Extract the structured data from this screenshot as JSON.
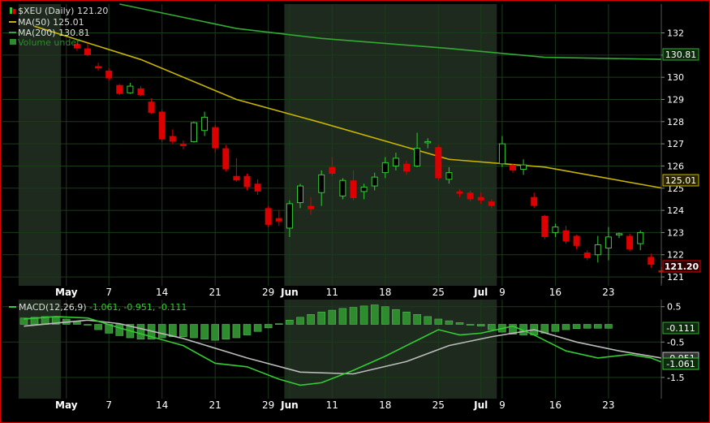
{
  "colors": {
    "background": "#000000",
    "grid": "#1a3d1a",
    "shade": "#1d2a1d",
    "up": "#33cc33",
    "down": "#dd0000",
    "ma50": "#c8b400",
    "ma200": "#33aa33",
    "text": "#ffffff",
    "legend_text": "#dddddd",
    "macd_line": "#33cc33",
    "signal_line": "#bbbbbb",
    "histogram": "#2e8b2e",
    "axis_border": "#dd0000"
  },
  "legend": {
    "symbol_line": "$XEU (Daily) 121.20",
    "ma50": "MA(50) 125.01",
    "ma200": "MA(200) 130.81",
    "volume": "Volume undef"
  },
  "macd_legend": {
    "label": "MACD(12,26,9)",
    "values": "-1.061, -0.951, -0.111"
  },
  "price_badges": {
    "ma200": "130.81",
    "ma50": "125.01",
    "last": "121.20"
  },
  "macd_badges": {
    "histogram": "-0.111",
    "signal": "-0.951",
    "macd": "-1.061"
  },
  "chart_data": {
    "type": "candlestick",
    "title": "$XEU (Daily) 121.20",
    "price_axis": {
      "ticks": [
        121,
        122,
        123,
        124,
        125,
        126,
        127,
        128,
        129,
        130,
        131,
        132
      ],
      "range": [
        120.6,
        133.3
      ]
    },
    "macd_axis": {
      "ticks": [
        "0.5",
        "-0.5",
        "-1.5"
      ],
      "tick_values": [
        0.5,
        -0.5,
        -1.5
      ],
      "range": [
        -2.1,
        0.7
      ]
    },
    "x_ticks": [
      {
        "label": "May",
        "i": -2,
        "bold": true
      },
      {
        "label": "7",
        "i": 2,
        "bold": false
      },
      {
        "label": "14",
        "i": 7,
        "bold": false
      },
      {
        "label": "21",
        "i": 12,
        "bold": false
      },
      {
        "label": "29",
        "i": 17,
        "bold": false
      },
      {
        "label": "Jun",
        "i": 19,
        "bold": true
      },
      {
        "label": "11",
        "i": 23,
        "bold": false
      },
      {
        "label": "18",
        "i": 28,
        "bold": false
      },
      {
        "label": "25",
        "i": 33,
        "bold": false
      },
      {
        "label": "Jul",
        "i": 37,
        "bold": true
      },
      {
        "label": "9",
        "i": 39,
        "bold": false
      },
      {
        "label": "16",
        "i": 44,
        "bold": false
      },
      {
        "label": "23",
        "i": 49,
        "bold": false
      }
    ],
    "shaded_ranges": [
      [
        -6.5,
        -2.5
      ],
      [
        18.5,
        38.5
      ]
    ],
    "candles": [
      [
        131.5,
        131.55,
        131.2,
        131.3
      ],
      [
        131.3,
        131.5,
        130.95,
        131.0
      ],
      [
        130.5,
        130.65,
        130.3,
        130.4
      ],
      [
        130.3,
        130.4,
        129.85,
        129.95
      ],
      [
        129.65,
        129.7,
        129.2,
        129.25
      ],
      [
        129.3,
        129.75,
        129.25,
        129.6
      ],
      [
        129.5,
        129.6,
        129.15,
        129.2
      ],
      [
        128.9,
        129.05,
        128.35,
        128.4
      ],
      [
        128.45,
        128.55,
        127.1,
        127.2
      ],
      [
        127.35,
        127.65,
        127.0,
        127.1
      ],
      [
        127.0,
        127.15,
        126.75,
        126.9
      ],
      [
        127.1,
        128.0,
        127.05,
        127.95
      ],
      [
        127.6,
        128.45,
        127.35,
        128.2
      ],
      [
        127.75,
        127.85,
        126.6,
        126.8
      ],
      [
        126.8,
        126.95,
        125.75,
        125.85
      ],
      [
        125.55,
        126.35,
        125.3,
        125.35
      ],
      [
        125.55,
        125.65,
        124.9,
        125.05
      ],
      [
        125.2,
        125.4,
        124.7,
        124.85
      ],
      [
        124.1,
        124.2,
        123.25,
        123.35
      ],
      [
        123.65,
        124.0,
        123.3,
        123.5
      ],
      [
        123.2,
        124.45,
        122.8,
        124.3
      ],
      [
        124.35,
        125.2,
        124.1,
        125.1
      ],
      [
        124.2,
        124.6,
        123.8,
        124.05
      ],
      [
        124.8,
        125.8,
        124.2,
        125.6
      ],
      [
        125.95,
        126.4,
        125.55,
        125.65
      ],
      [
        124.65,
        125.45,
        124.5,
        125.35
      ],
      [
        125.35,
        125.8,
        124.45,
        124.55
      ],
      [
        124.85,
        125.2,
        124.5,
        125.05
      ],
      [
        125.1,
        125.7,
        124.9,
        125.5
      ],
      [
        125.7,
        126.4,
        125.45,
        126.15
      ],
      [
        126.0,
        126.6,
        125.8,
        126.35
      ],
      [
        126.1,
        126.25,
        125.6,
        125.75
      ],
      [
        126.0,
        127.5,
        125.95,
        126.8
      ],
      [
        127.05,
        127.25,
        126.8,
        127.1
      ],
      [
        126.85,
        126.95,
        125.35,
        125.45
      ],
      [
        125.4,
        125.95,
        125.2,
        125.7
      ],
      [
        124.85,
        124.95,
        124.6,
        124.75
      ],
      [
        124.8,
        124.9,
        124.4,
        124.5
      ],
      [
        124.6,
        124.8,
        124.3,
        124.45
      ],
      [
        124.4,
        124.5,
        124.1,
        124.2
      ],
      [
        126.1,
        127.35,
        125.95,
        127.0
      ],
      [
        126.05,
        126.1,
        125.7,
        125.8
      ],
      [
        125.85,
        126.3,
        125.6,
        126.05
      ],
      [
        124.6,
        124.8,
        124.1,
        124.2
      ],
      [
        123.75,
        123.8,
        122.7,
        122.8
      ],
      [
        123.0,
        123.4,
        122.8,
        123.25
      ],
      [
        123.1,
        123.3,
        122.5,
        122.6
      ],
      [
        122.85,
        122.9,
        122.25,
        122.4
      ],
      [
        122.1,
        122.2,
        121.75,
        121.85
      ],
      [
        122.0,
        122.85,
        121.65,
        122.45
      ],
      [
        122.3,
        123.25,
        121.75,
        122.8
      ],
      [
        122.9,
        123.0,
        122.75,
        122.95
      ],
      [
        122.85,
        122.95,
        122.15,
        122.25
      ],
      [
        122.5,
        123.1,
        122.2,
        123.0
      ],
      [
        121.9,
        122.05,
        121.4,
        121.55
      ],
      [
        121.3,
        121.45,
        120.7,
        121.2
      ]
    ],
    "ma50": [
      [
        -5,
        132.3
      ],
      [
        5,
        130.8
      ],
      [
        14,
        129.0
      ],
      [
        22,
        127.95
      ],
      [
        34,
        126.3
      ],
      [
        43,
        125.95
      ],
      [
        54,
        125.01
      ]
    ],
    "ma200": [
      [
        3,
        133.3
      ],
      [
        14,
        132.2
      ],
      [
        22,
        131.75
      ],
      [
        34,
        131.3
      ],
      [
        43,
        130.9
      ],
      [
        54,
        130.81
      ]
    ],
    "macd": [
      [
        -6,
        0.15
      ],
      [
        -3,
        0.22
      ],
      [
        0,
        0.18
      ],
      [
        3,
        -0.1
      ],
      [
        6,
        -0.35
      ],
      [
        9,
        -0.6
      ],
      [
        12,
        -1.1
      ],
      [
        15,
        -1.2
      ],
      [
        18,
        -1.55
      ],
      [
        20,
        -1.72
      ],
      [
        22,
        -1.65
      ],
      [
        25,
        -1.3
      ],
      [
        28,
        -0.9
      ],
      [
        31,
        -0.45
      ],
      [
        33,
        -0.15
      ],
      [
        35,
        -0.3
      ],
      [
        37,
        -0.25
      ],
      [
        40,
        -0.05
      ],
      [
        42,
        -0.3
      ],
      [
        45,
        -0.75
      ],
      [
        48,
        -0.95
      ],
      [
        51,
        -0.85
      ],
      [
        53,
        -0.95
      ],
      [
        54,
        -1.061
      ]
    ],
    "signal": [
      [
        -6,
        -0.05
      ],
      [
        0,
        0.12
      ],
      [
        3,
        0.02
      ],
      [
        9,
        -0.4
      ],
      [
        15,
        -0.95
      ],
      [
        20,
        -1.35
      ],
      [
        25,
        -1.4
      ],
      [
        30,
        -1.05
      ],
      [
        34,
        -0.6
      ],
      [
        38,
        -0.35
      ],
      [
        42,
        -0.15
      ],
      [
        46,
        -0.5
      ],
      [
        50,
        -0.75
      ],
      [
        54,
        -0.951
      ]
    ],
    "histogram": [
      0.18,
      0.2,
      0.22,
      0.2,
      0.15,
      0.08,
      -0.02,
      -0.15,
      -0.25,
      -0.32,
      -0.38,
      -0.42,
      -0.42,
      -0.38,
      -0.35,
      -0.35,
      -0.38,
      -0.42,
      -0.45,
      -0.42,
      -0.38,
      -0.3,
      -0.2,
      -0.1,
      0.02,
      0.12,
      0.2,
      0.28,
      0.35,
      0.4,
      0.45,
      0.48,
      0.52,
      0.55,
      0.5,
      0.42,
      0.35,
      0.28,
      0.22,
      0.15,
      0.1,
      0.05,
      0.0,
      -0.05,
      -0.15,
      -0.22,
      -0.28,
      -0.3,
      -0.3,
      -0.25,
      -0.2,
      -0.15,
      -0.12,
      -0.11,
      -0.11,
      -0.111
    ]
  }
}
